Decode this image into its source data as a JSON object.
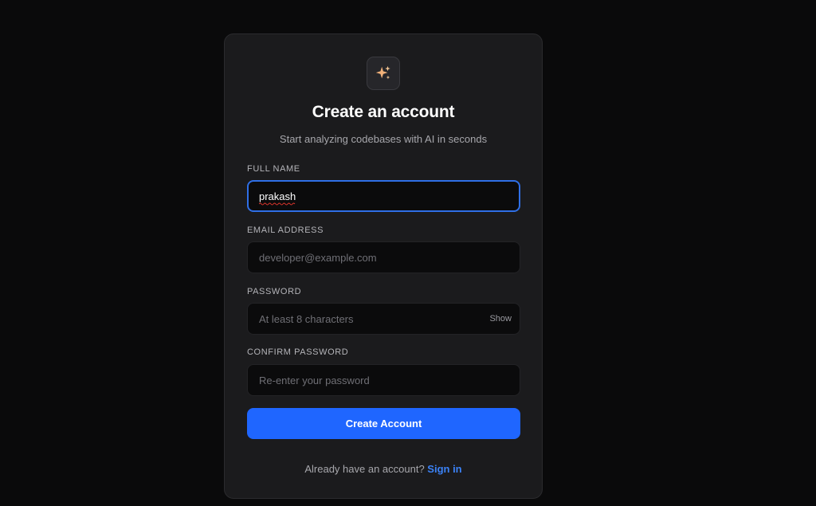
{
  "header": {
    "logo_icon": "sparkles-icon",
    "title": "Create an account",
    "subtitle": "Start analyzing codebases with AI in seconds"
  },
  "form": {
    "full_name": {
      "label": "FULL NAME",
      "value": "prakash",
      "placeholder": ""
    },
    "email": {
      "label": "EMAIL ADDRESS",
      "value": "",
      "placeholder": "developer@example.com"
    },
    "password": {
      "label": "PASSWORD",
      "value": "",
      "placeholder": "At least 8 characters",
      "toggle_label": "Show"
    },
    "confirm_password": {
      "label": "CONFIRM PASSWORD",
      "value": "",
      "placeholder": "Re-enter your password"
    },
    "submit_label": "Create Account"
  },
  "footer": {
    "prompt": "Already have an account?",
    "link_label": "Sign in"
  },
  "colors": {
    "accent": "#1f66ff",
    "link": "#3b82f6",
    "focus_ring": "#2f6fe6",
    "sparkle": "#f2b27a"
  }
}
